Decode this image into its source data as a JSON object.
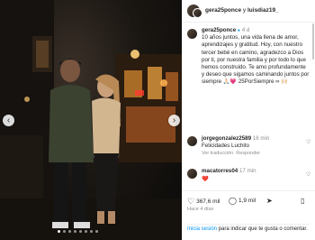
{
  "post": {
    "header": {
      "user1": "gera25ponce",
      "conj": " y ",
      "user2": "luisdiaz19_"
    },
    "caption": {
      "username": "gera25ponce",
      "verified_icon": "verified-icon",
      "time": "4 d",
      "text": "10 años juntos, una vida llena de amor, aprendizajes y gratitud. Hoy, con nuestro tercer bebé en camino, agradezco a Dios por ti, por nuestra familia y por todo lo que hemos construido. Te amo profundamente y deseo que sigamos caminando juntos por siempre 🙏🏻💗 25PorSiempre ∞ 🙌🏻"
    },
    "comments": [
      {
        "username": "jorgegonzalez2589",
        "time": "16 min",
        "text": "Felicidades Luchito",
        "meta1": "Ver traducción",
        "meta2": "Responder"
      },
      {
        "username": "macatorres04",
        "time": "17 min",
        "text": "❤️"
      }
    ],
    "actions": {
      "likes": "367,6 mil",
      "comments": "1,9 mil"
    },
    "date": "Hace 4 días",
    "login": {
      "link": "Inicia sesión",
      "rest": " para indicar que te gusta o comentar."
    }
  },
  "colors": {
    "link": "#0095f6",
    "heart": "#ed4956"
  }
}
